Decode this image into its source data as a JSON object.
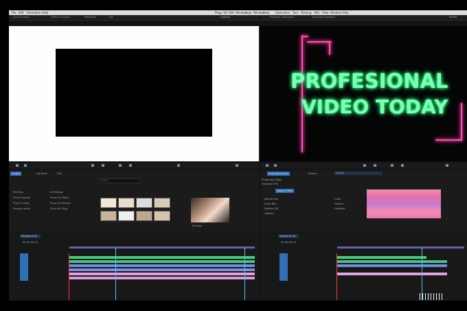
{
  "menu": {
    "items": [
      "File",
      "Edit",
      "Animation",
      "Help",
      "Plugs",
      "3D",
      "Edit",
      "Window",
      "Help",
      "Window",
      "Help",
      "Options",
      "Ins",
      "Tool",
      "Sharing",
      "Win",
      "View",
      "Window",
      "Help"
    ]
  },
  "source_monitor": {
    "tabs": [
      "Source panel",
      "Effect Controls",
      "Metadata",
      "Clip"
    ],
    "timecode_right": "Quarter"
  },
  "program_monitor": {
    "tabs": [
      "Program: Sequence",
      "Essential Graphics"
    ],
    "timecode_right": "Preset",
    "title_line1": "PROFESIONAL",
    "title_line2": "VIDEO TODAY",
    "neon_color": "#ff4fb0",
    "text_color": "#7dffb5"
  },
  "project_panel": {
    "tabs": [
      "Project",
      "Libraries",
      "Info"
    ],
    "tree": [
      "File Bins",
      "Proxy Queues",
      "Proxy Curves",
      "Proxies cache"
    ],
    "tree2": [
      "Art Design",
      "Proxy 2A Fades",
      "Proxy Art Design",
      "Extra Art Trigs"
    ],
    "search_placeholder": "Search",
    "preview_label": "Preview"
  },
  "effects_panel": {
    "tabs": [
      "Essential Sound",
      "Effects",
      "Search"
    ],
    "heading": "Properties Video",
    "heading2": "Overlays VFX",
    "tab_active": "Legacy Titles",
    "props": [
      "Motion Blur",
      "Scale Blur",
      "Position 2D",
      "Opacity"
    ],
    "label_color": "Color",
    "label_text": "Outline",
    "label_grade": "Gradient"
  },
  "timeline_left": {
    "sequence_tab": "Sequence 01",
    "timecode": "00;00;00;00"
  },
  "timeline_right": {
    "sequence_tab": "Sequence 02",
    "timecode": "00;00;00;00"
  },
  "colors": {
    "accent_blue": "#2f6fb5",
    "track_green": "#3fd07a",
    "track_blue": "#6d8fe0",
    "track_pink": "#e1a3df",
    "playhead": "#52c3ff"
  }
}
